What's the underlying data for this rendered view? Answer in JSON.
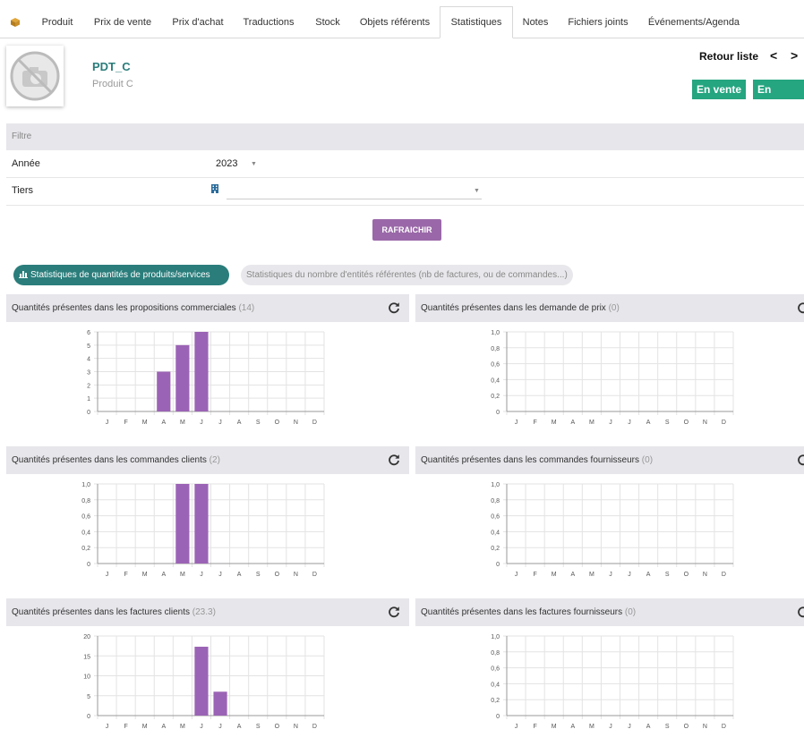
{
  "tabs": [
    {
      "label": "Produit",
      "active": false
    },
    {
      "label": "Prix de vente",
      "active": false
    },
    {
      "label": "Prix d'achat",
      "active": false
    },
    {
      "label": "Traductions",
      "active": false
    },
    {
      "label": "Stock",
      "active": false
    },
    {
      "label": "Objets référents",
      "active": false
    },
    {
      "label": "Statistiques",
      "active": true
    },
    {
      "label": "Notes",
      "active": false
    },
    {
      "label": "Fichiers joints",
      "active": false
    },
    {
      "label": "Événements/Agenda",
      "active": false
    }
  ],
  "header": {
    "ref": "PDT_C",
    "label": "Produit C",
    "back_label": "Retour liste",
    "prev_label": "<",
    "next_label": ">",
    "badge_sale": "En vente",
    "badge_purchase": "En achat"
  },
  "filter": {
    "title": "Filtre",
    "year_label": "Année",
    "year_value": "2023",
    "tiers_label": "Tiers",
    "tiers_value": ""
  },
  "refresh_button": "RAFRAICHIR",
  "stats_tabs": {
    "active_label": "Statistiques de quantités de produits/services",
    "inactive_label": "Statistiques du nombre d'entités référentes (nb de factures, ou de commandes...)"
  },
  "colors": {
    "bar": "#9b63b5",
    "accent": "#2a7d7b",
    "badge": "#25a580"
  },
  "chart_data": [
    {
      "type": "bar",
      "title": "Quantités présentes dans les propositions commerciales",
      "count": "(14)",
      "categories": [
        "J",
        "F",
        "M",
        "A",
        "M",
        "J",
        "J",
        "A",
        "S",
        "O",
        "N",
        "D"
      ],
      "values": [
        0,
        0,
        0,
        3,
        5,
        6,
        0,
        0,
        0,
        0,
        0,
        0
      ],
      "ylim": [
        0,
        6
      ],
      "yticks": [
        "0",
        "1",
        "2",
        "3",
        "4",
        "5",
        "6"
      ]
    },
    {
      "type": "bar",
      "title": "Quantités présentes dans les demande de prix",
      "count": "(0)",
      "categories": [
        "J",
        "F",
        "M",
        "A",
        "M",
        "J",
        "J",
        "A",
        "S",
        "O",
        "N",
        "D"
      ],
      "values": [
        0,
        0,
        0,
        0,
        0,
        0,
        0,
        0,
        0,
        0,
        0,
        0
      ],
      "ylim": [
        0,
        1
      ],
      "yticks": [
        "0",
        "0,2",
        "0,4",
        "0,6",
        "0,8",
        "1,0"
      ]
    },
    {
      "type": "bar",
      "title": "Quantités présentes dans les commandes clients",
      "count": "(2)",
      "categories": [
        "J",
        "F",
        "M",
        "A",
        "M",
        "J",
        "J",
        "A",
        "S",
        "O",
        "N",
        "D"
      ],
      "values": [
        0,
        0,
        0,
        0,
        1,
        1,
        0,
        0,
        0,
        0,
        0,
        0
      ],
      "ylim": [
        0,
        1
      ],
      "yticks": [
        "0",
        "0,2",
        "0,4",
        "0,6",
        "0,8",
        "1,0"
      ]
    },
    {
      "type": "bar",
      "title": "Quantités présentes dans les commandes fournisseurs",
      "count": "(0)",
      "categories": [
        "J",
        "F",
        "M",
        "A",
        "M",
        "J",
        "J",
        "A",
        "S",
        "O",
        "N",
        "D"
      ],
      "values": [
        0,
        0,
        0,
        0,
        0,
        0,
        0,
        0,
        0,
        0,
        0,
        0
      ],
      "ylim": [
        0,
        1
      ],
      "yticks": [
        "0",
        "0,2",
        "0,4",
        "0,6",
        "0,8",
        "1,0"
      ]
    },
    {
      "type": "bar",
      "title": "Quantités présentes dans les factures clients",
      "count": "(23.3)",
      "categories": [
        "J",
        "F",
        "M",
        "A",
        "M",
        "J",
        "J",
        "A",
        "S",
        "O",
        "N",
        "D"
      ],
      "values": [
        0,
        0,
        0,
        0,
        0,
        17.3,
        6,
        0,
        0,
        0,
        0,
        0
      ],
      "ylim": [
        0,
        20
      ],
      "yticks": [
        "0",
        "5",
        "10",
        "15",
        "20"
      ]
    },
    {
      "type": "bar",
      "title": "Quantités présentes dans les factures fournisseurs",
      "count": "(0)",
      "categories": [
        "J",
        "F",
        "M",
        "A",
        "M",
        "J",
        "J",
        "A",
        "S",
        "O",
        "N",
        "D"
      ],
      "values": [
        0,
        0,
        0,
        0,
        0,
        0,
        0,
        0,
        0,
        0,
        0,
        0
      ],
      "ylim": [
        0,
        1
      ],
      "yticks": [
        "0",
        "0,2",
        "0,4",
        "0,6",
        "0,8",
        "1,0"
      ]
    }
  ]
}
